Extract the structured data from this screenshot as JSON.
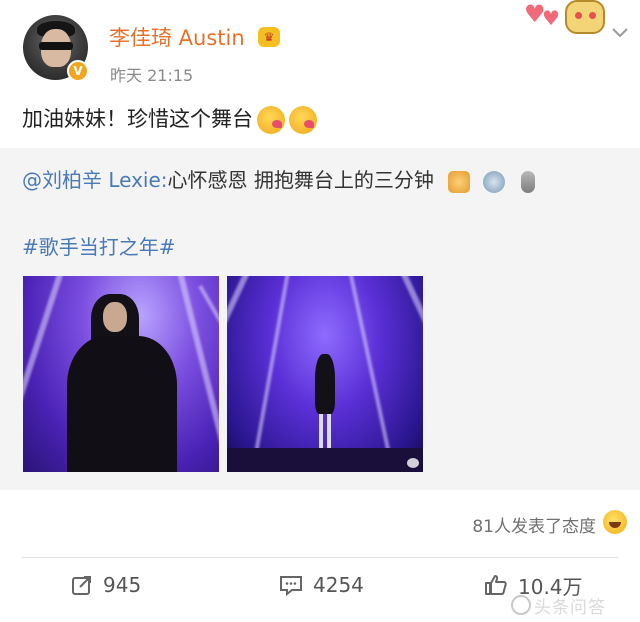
{
  "post": {
    "author": "李佳琦 Austin",
    "time": "昨天 21:15",
    "text": "加油妹妹！珍惜这个舞台",
    "verified_badge": "V",
    "emoji_icons": [
      "grin-heart-emoji",
      "grin-heart-emoji"
    ]
  },
  "repost": {
    "mention": "@刘柏辛 Lexie:",
    "text": "心怀感恩 拥抱舞台上的三分钟",
    "trailing_icons": [
      "fist-emoji",
      "robot-emoji",
      "microphone-emoji"
    ],
    "hashtag": "#歌手当打之年#",
    "images": [
      "stage-photo-1",
      "stage-photo-2"
    ]
  },
  "reactions": {
    "text": "81人发表了态度",
    "icon": "laugh-emoji"
  },
  "actions": {
    "repost_count": "945",
    "comment_count": "4254",
    "like_count": "10.4万"
  },
  "watermark": {
    "text": "头条问答"
  },
  "colors": {
    "username": "#e8712a",
    "link": "#4a79b8",
    "repost_bg": "#f4f4f4"
  }
}
